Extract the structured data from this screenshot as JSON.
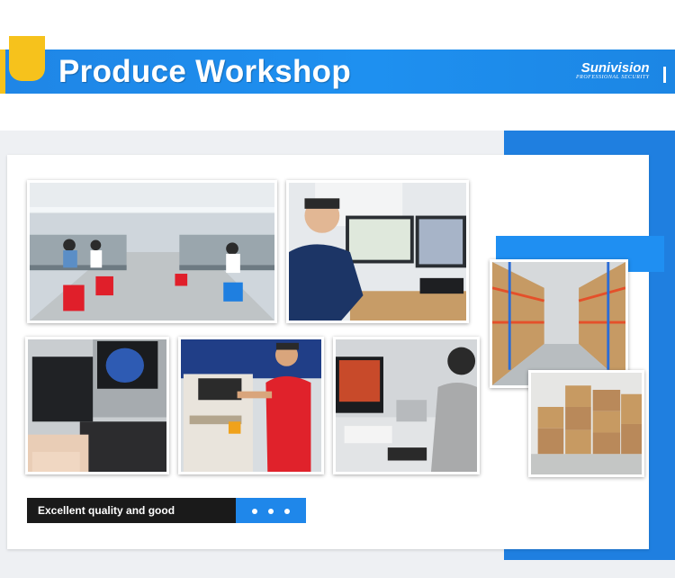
{
  "banner": {
    "title": "Produce Workshop",
    "brand_name": "Sunivision",
    "brand_tagline": "PROFESSIONAL SECURITY"
  },
  "caption": {
    "text": "Excellent quality and good performance",
    "dot_count": 3
  },
  "colors": {
    "accent_blue": "#1f86e6",
    "accent_yellow": "#f6c21c",
    "caption_dark": "#1a1a1a"
  }
}
